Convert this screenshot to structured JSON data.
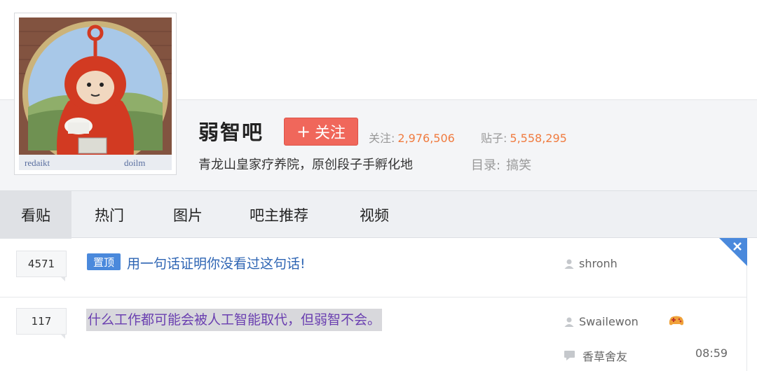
{
  "forum": {
    "name": "弱智吧",
    "follow_label": "关注",
    "follow_plus": "+",
    "stats": {
      "follow_label": "关注:",
      "follow_count": "2,976,506",
      "posts_label": "贴子:",
      "posts_count": "5,558,295"
    },
    "slogan": "青龙山皇家疗养院，原创段子手孵化地",
    "catalog_label": "目录:",
    "catalog_value": "搞笑"
  },
  "tabs": [
    {
      "label": "看贴",
      "active": true
    },
    {
      "label": "热门"
    },
    {
      "label": "图片"
    },
    {
      "label": "吧主推荐"
    },
    {
      "label": "视频"
    }
  ],
  "threads": [
    {
      "replies": "4571",
      "badge": "置顶",
      "title": "用一句话证明你没看过这句话!",
      "author": "shronh"
    },
    {
      "replies": "117",
      "title": "什么工作都可能会被人工智能取代，但弱智不会。",
      "author": "Swailewon",
      "last_reply_user": "香草舍友",
      "last_reply_time": "08:59"
    }
  ],
  "icons": {
    "user": "user-icon",
    "comment": "comment-icon",
    "close": "close-icon",
    "game": "game-controller-icon"
  },
  "colors": {
    "follow_button": "#f0675b",
    "stat_number": "#f07b3f",
    "link_blue": "#2d64b3",
    "visited_purple": "#6a3fb0",
    "pin_badge": "#4a89dc"
  }
}
